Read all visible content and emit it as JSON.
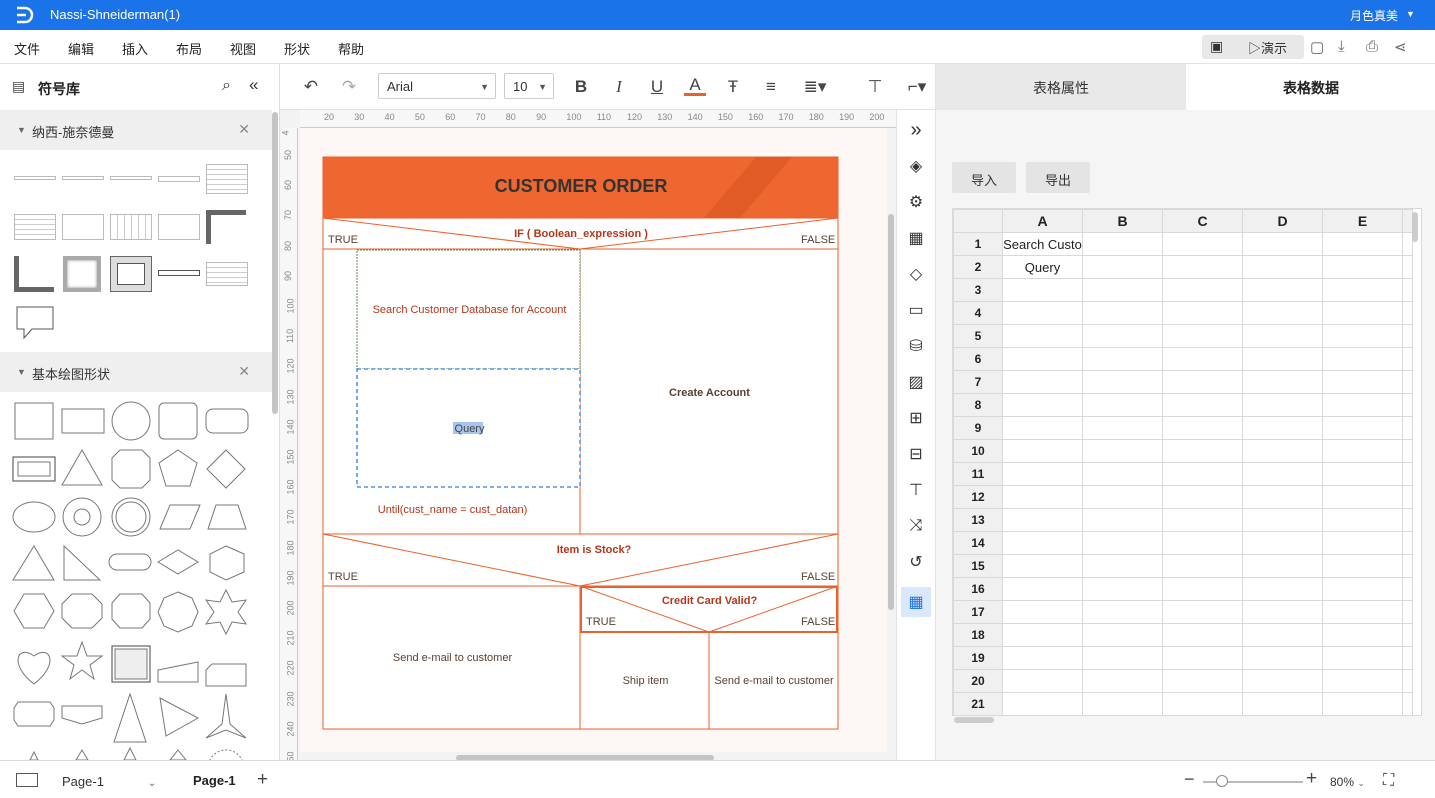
{
  "app": {
    "title": "Nassi-Shneiderman(1)",
    "user": "月色真美"
  },
  "menu": [
    "文件",
    "编辑",
    "插入",
    "布局",
    "视图",
    "形状",
    "帮助"
  ],
  "header_right": {
    "present_label": "演示"
  },
  "toolbar": {
    "font": "Arial",
    "size": "10"
  },
  "library": {
    "title": "符号库",
    "sections": [
      {
        "label": "纳西-施奈德曼"
      },
      {
        "label": "基本绘图形状"
      }
    ]
  },
  "ruler": {
    "h": [
      "20",
      "30",
      "40",
      "50",
      "60",
      "70",
      "80",
      "90",
      "100",
      "110",
      "120",
      "130",
      "140",
      "150",
      "160",
      "170",
      "180",
      "190",
      "200"
    ],
    "v": [
      "4",
      "50",
      "60",
      "70",
      "80",
      "90",
      "100",
      "110",
      "120",
      "130",
      "140",
      "150",
      "160",
      "170",
      "180",
      "190",
      "200",
      "210",
      "220",
      "230",
      "240",
      "250"
    ]
  },
  "diagram": {
    "title": "CUSTOMER ORDER",
    "if1": "IF ( Boolean_expression )",
    "true1": "TRUE",
    "false1": "FALSE",
    "search": "Search Customer Database for Account",
    "query": "Query",
    "until": "Until(cust_name = cust_datan)",
    "create": "Create Account",
    "if2": "Item is Stock?",
    "true2": "TRUE",
    "false2": "FALSE",
    "email1": "Send e-mail to customer",
    "if3": "Credit Card Valid?",
    "true3": "TRUE",
    "false3": "FALSE",
    "ship": "Ship item",
    "email2": "Send e-mail to customer"
  },
  "rpanel": {
    "tabs": [
      "表格属性",
      "表格数据"
    ],
    "import_label": "导入",
    "export_label": "导出",
    "columns": [
      "A",
      "B",
      "C",
      "D",
      "E"
    ],
    "rows": [
      "1",
      "2",
      "3",
      "4",
      "5",
      "6",
      "7",
      "8",
      "9",
      "10",
      "11",
      "12",
      "13",
      "14",
      "15",
      "16",
      "17",
      "18",
      "19",
      "20",
      "21"
    ],
    "cells": {
      "1": "Search Custo",
      "2": "Query"
    }
  },
  "bottom": {
    "page_select": "Page-1",
    "page_tab": "Page-1",
    "zoom": "80%"
  },
  "colors": {
    "accent": "#1a73e8",
    "diagram_orange": "#e8622c",
    "title_band": "#ee6630"
  }
}
